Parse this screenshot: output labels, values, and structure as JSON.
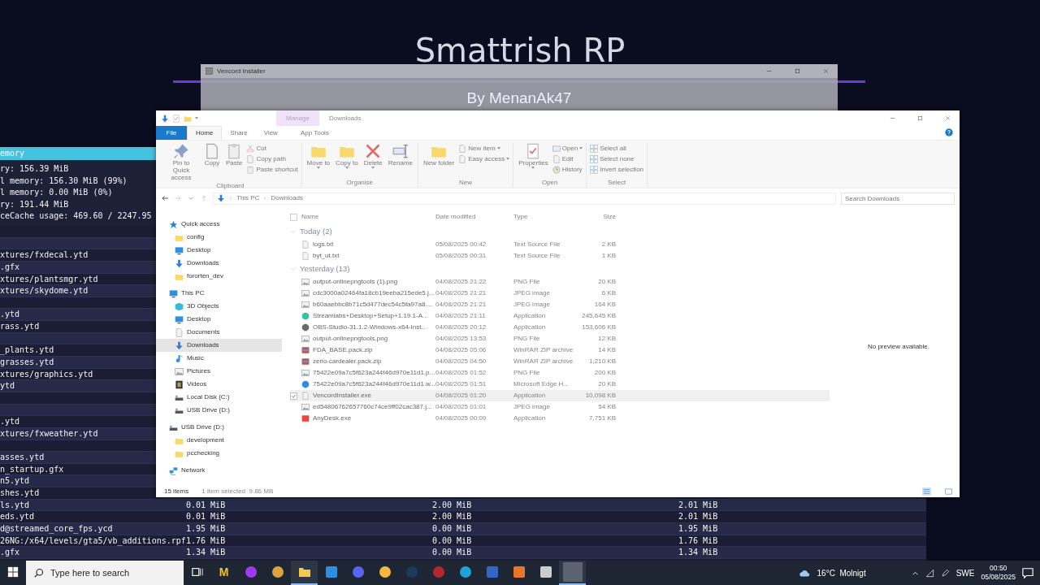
{
  "background": {
    "title": "Smattrish RP"
  },
  "debug_panel": {
    "header": "emory",
    "stats": [
      "ry: 156.39 MiB",
      "l memory: 156.30 MiB (99%)",
      "l memory: 0.00 MiB (0%)",
      "ry: 191.44 MiB",
      "ceCache usage: 469.60 / 2247.95"
    ],
    "rows": [
      {
        "kind": "blank"
      },
      {
        "kind": "blank"
      },
      {
        "kind": "entry",
        "name": "xtures/fxdecal.ytd"
      },
      {
        "kind": "entry",
        "name": ".gfx"
      },
      {
        "kind": "entry",
        "name": "xtures/plantsmgr.ytd"
      },
      {
        "kind": "entry",
        "name": "xtures/skydome.ytd"
      },
      {
        "kind": "blank"
      },
      {
        "kind": "entry",
        "name": ".ytd"
      },
      {
        "kind": "entry",
        "name": "rass.ytd"
      },
      {
        "kind": "blank"
      },
      {
        "kind": "entry",
        "name": "_plants.ytd"
      },
      {
        "kind": "entry",
        "name": "grasses.ytd"
      },
      {
        "kind": "entry",
        "name": "xtures/graphics.ytd"
      },
      {
        "kind": "entry",
        "name": "ytd"
      },
      {
        "kind": "blank"
      },
      {
        "kind": "blank"
      },
      {
        "kind": "entry",
        "name": ".ytd"
      },
      {
        "kind": "entry",
        "name": "xtures/fxweather.ytd"
      },
      {
        "kind": "blank"
      },
      {
        "kind": "entry",
        "name": "asses.ytd"
      },
      {
        "kind": "entry",
        "name": "n_startup.gfx"
      },
      {
        "kind": "entry",
        "name": "n5.ytd"
      },
      {
        "kind": "entry",
        "name": "shes.ytd"
      },
      {
        "kind": "entry",
        "name": "ls.ytd",
        "values": [
          "0.01 MiB",
          "2.00 MiB",
          "2.01 MiB"
        ]
      },
      {
        "kind": "entry",
        "name": "eds.ytd",
        "values": [
          "0.01 MiB",
          "2.00 MiB",
          "2.01 MiB"
        ]
      },
      {
        "kind": "entry",
        "name": "d@streamed_core_fps.ycd",
        "values": [
          "1.95 MiB",
          "0.00 MiB",
          "1.95 MiB"
        ]
      },
      {
        "kind": "entry",
        "name": "26NG:/x64/levels/gta5/vb_additions.rpf",
        "values": [
          "1.76 MiB",
          "0.00 MiB",
          "1.76 MiB"
        ]
      },
      {
        "kind": "entry",
        "name": ".gfx",
        "values": [
          "1.34 MiB",
          "0.00 MiB",
          "1.34 MiB"
        ]
      }
    ]
  },
  "installer": {
    "title": "Vencord Installer",
    "subtitle": "By MenanAk47"
  },
  "explorer": {
    "context_tab": "Manage",
    "window_title": "Downloads",
    "tabs": [
      {
        "label": "File",
        "kind": "file",
        "selected": false
      },
      {
        "label": "Home",
        "kind": "normal",
        "selected": true
      },
      {
        "label": "Share",
        "kind": "normal",
        "selected": false
      },
      {
        "label": "View",
        "kind": "normal",
        "selected": false
      },
      {
        "label": "App Tools",
        "kind": "context",
        "selected": false
      }
    ],
    "ribbon": [
      {
        "label": "Clipboard",
        "large": [
          {
            "label": "Pin to Quick access",
            "kind": "pin"
          },
          {
            "label": "Copy",
            "kind": "document"
          },
          {
            "label": "Paste",
            "kind": "clipboard"
          }
        ],
        "small": [
          {
            "label": "Cut",
            "kind": "scissors"
          },
          {
            "label": "Copy path",
            "kind": "document"
          },
          {
            "label": "Paste shortcut",
            "kind": "clipboard"
          }
        ]
      },
      {
        "label": "Organise",
        "large": [
          {
            "label": "Move to",
            "kind": "folder",
            "dropdown": true
          },
          {
            "label": "Copy to",
            "kind": "folder",
            "dropdown": true
          },
          {
            "label": "Delete",
            "kind": "cross",
            "dropdown": true
          },
          {
            "label": "Rename",
            "kind": "textfield",
            "dropdown": false
          }
        ]
      },
      {
        "label": "New",
        "large": [
          {
            "label": "New folder",
            "kind": "folder",
            "dropdown": false
          }
        ],
        "small": [
          {
            "label": "New item",
            "kind": "document",
            "dropdown": true
          },
          {
            "label": "Easy access",
            "kind": "document",
            "dropdown": true
          }
        ]
      },
      {
        "label": "Open",
        "large": [
          {
            "label": "Properties",
            "kind": "check",
            "dropdown": true
          }
        ],
        "small": [
          {
            "label": "Open",
            "kind": "window",
            "dropdown": true
          },
          {
            "label": "Edit",
            "kind": "document",
            "dropdown": false
          },
          {
            "label": "History",
            "kind": "clock",
            "dropdown": false
          }
        ]
      },
      {
        "label": "Select",
        "small": [
          {
            "label": "Select all",
            "kind": "grid"
          },
          {
            "label": "Select none",
            "kind": "grid"
          },
          {
            "label": "Invert selection",
            "kind": "grid"
          }
        ]
      }
    ],
    "address": [
      "This PC",
      "Downloads"
    ],
    "search": {
      "placeholder": "Search Downloads"
    },
    "nav": [
      {
        "label": "Quick access",
        "kind": "star",
        "selected": false,
        "children": [
          {
            "label": "config",
            "kind": "folder",
            "selected": false
          },
          {
            "label": "Desktop",
            "kind": "monitor",
            "selected": false
          },
          {
            "label": "Downloads",
            "kind": "down-arrow",
            "selected": false
          },
          {
            "label": "fororten_dev",
            "kind": "folder",
            "selected": false
          }
        ]
      },
      {
        "label": "This PC",
        "kind": "monitor",
        "selected": false,
        "children": [
          {
            "label": "3D Objects",
            "kind": "cube",
            "selected": false
          },
          {
            "label": "Desktop",
            "kind": "monitor",
            "selected": false
          },
          {
            "label": "Documents",
            "kind": "document",
            "selected": false
          },
          {
            "label": "Downloads",
            "kind": "down-arrow",
            "selected": true
          },
          {
            "label": "Music",
            "kind": "music",
            "selected": false
          },
          {
            "label": "Pictures",
            "kind": "image",
            "selected": false
          },
          {
            "label": "Videos",
            "kind": "film",
            "selected": false
          },
          {
            "label": "Local Disk (C:)",
            "kind": "drive",
            "selected": false
          },
          {
            "label": "USB Drive (D:)",
            "kind": "drive",
            "selected": false
          }
        ]
      },
      {
        "label": "USB Drive (D:)",
        "kind": "drive",
        "selected": false,
        "children": [
          {
            "label": "development",
            "kind": "folder",
            "selected": false
          },
          {
            "label": "pcchecking",
            "kind": "folder",
            "selected": false
          }
        ]
      },
      {
        "label": "Network",
        "kind": "network",
        "selected": false
      }
    ],
    "select_all_checked": false,
    "columns": [
      "Name",
      "Date modified",
      "Type",
      "Size"
    ],
    "groups": [
      {
        "label": "Today (2)",
        "expanded": true,
        "files": [
          {
            "name": "logs.txt",
            "date": "05/08/2025 00:42",
            "type": "Text Source File",
            "size": "2 KB",
            "kind": "document",
            "selected": false
          },
          {
            "name": "byt_ut.txt",
            "date": "05/08/2025 00:31",
            "type": "Text Source File",
            "size": "1 KB",
            "kind": "document",
            "selected": false
          }
        ]
      },
      {
        "label": "Yesterday (13)",
        "expanded": true,
        "files": [
          {
            "name": "output-onlinepngtools (1).png",
            "date": "04/08/2025 21:22",
            "type": "PNG File",
            "size": "20 KB",
            "kind": "image",
            "selected": false
          },
          {
            "name": "cdc3000a02464fa18cb19eeba215ede5.j...",
            "date": "04/08/2025 21:21",
            "type": "JPEG image",
            "size": "6 KB",
            "kind": "image",
            "selected": false
          },
          {
            "name": "b60aaebbc8b71c5d477dec54c5fa97a8....",
            "date": "04/08/2025 21:21",
            "type": "JPEG image",
            "size": "164 KB",
            "kind": "image",
            "selected": false
          },
          {
            "name": "Streamlabs+Desktop+Setup+1.19.1-A...",
            "date": "04/08/2025 21:11",
            "type": "Application",
            "size": "245,645 KB",
            "kind": "round-logo",
            "color": "#31c3a2",
            "selected": false
          },
          {
            "name": "OBS-Studio-31.1.2-Windows-x64-Inst...",
            "date": "04/08/2025 20:12",
            "type": "Application",
            "size": "153,606 KB",
            "kind": "round-logo",
            "color": "#6b6b6b",
            "selected": false
          },
          {
            "name": "output-onlinepngtools.png",
            "date": "04/08/2025 13:53",
            "type": "PNG File",
            "size": "12 KB",
            "kind": "image",
            "selected": false
          },
          {
            "name": "FDA_BASE.pack.zip",
            "date": "04/08/2025 05:06",
            "type": "WinRAR ZIP archive",
            "size": "14 KB",
            "kind": "archive",
            "selected": false
          },
          {
            "name": "zerio-cardealer.pack.zip",
            "date": "04/08/2025 04:50",
            "type": "WinRAR ZIP archive",
            "size": "1,210 KB",
            "kind": "archive",
            "selected": false
          },
          {
            "name": "75422e09a7c5f623a244f46d970e11d1.p...",
            "date": "04/08/2025 01:52",
            "type": "PNG File",
            "size": "200 KB",
            "kind": "image",
            "selected": false
          },
          {
            "name": "75422e09a7c5f623a244f46d970e11d1.w...",
            "date": "04/08/2025 01:51",
            "type": "Microsoft Edge H...",
            "size": "20 KB",
            "kind": "round-logo",
            "color": "#2f8fd8",
            "selected": false
          },
          {
            "name": "VencordInstaller.exe",
            "date": "04/08/2025 01:20",
            "type": "Application",
            "size": "10,098 KB",
            "kind": "document",
            "selected": true
          },
          {
            "name": "ed54806762657760c74ce9ff02cac387.j...",
            "date": "04/08/2025 01:01",
            "type": "JPEG image",
            "size": "54 KB",
            "kind": "image",
            "selected": false
          },
          {
            "name": "AnyDesk.exe",
            "date": "04/08/2025 00:09",
            "type": "Application",
            "size": "7,751 KB",
            "kind": "square-logo",
            "color": "#ef4444",
            "selected": false
          }
        ]
      }
    ],
    "preview": "No preview available.",
    "status": [
      "15 items",
      "1 item selected  9.86 MB"
    ]
  },
  "taskbar": {
    "search": "Type here to search",
    "apps": [
      {
        "kind": "taskview",
        "active": false
      },
      {
        "kind": "letter",
        "text": "M",
        "color": "#f5c518",
        "active": false
      },
      {
        "kind": "round",
        "color": "#9b3cf0",
        "active": false
      },
      {
        "kind": "round",
        "color": "#d9a441",
        "active": false
      },
      {
        "kind": "folder",
        "color": "#f2c94c",
        "active": true
      },
      {
        "kind": "square",
        "color": "#2d8fe0",
        "active": false
      },
      {
        "kind": "round",
        "color": "#5865f2",
        "active": false
      },
      {
        "kind": "round",
        "color": "#f5b83d",
        "active": false
      },
      {
        "kind": "round",
        "color": "#1b3a5c",
        "active": false
      },
      {
        "kind": "round",
        "color": "#b3262d",
        "active": false
      },
      {
        "kind": "round",
        "color": "#1fa2d8",
        "active": false
      },
      {
        "kind": "square",
        "color": "#3464c4",
        "active": false
      },
      {
        "kind": "square",
        "color": "#e8752b",
        "active": false
      },
      {
        "kind": "square",
        "color": "#c9ccd1",
        "active": false
      },
      {
        "kind": "tile",
        "color": "#5b6270",
        "active": true
      }
    ],
    "weather": "16°C  Molnigt",
    "language": "SWE",
    "time": "00:50",
    "date": "05/08/2025"
  }
}
